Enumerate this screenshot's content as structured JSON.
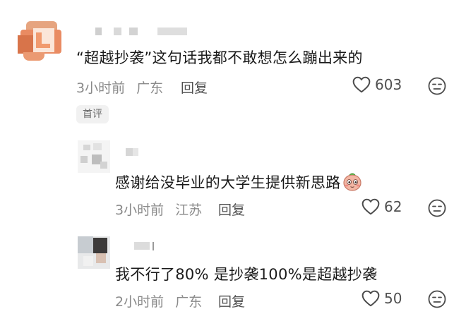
{
  "comments": [
    {
      "text": "“超越抄袭”这句话我都不敢想怎么蹦出来的",
      "time": "3小时前",
      "location": "广东",
      "reply": "回复",
      "likes": "603",
      "badge": "首评"
    },
    {
      "text": "感谢给没毕业的大学生提供新思路",
      "time": "3小时前",
      "location": "江苏",
      "reply": "回复",
      "likes": "62"
    },
    {
      "text": "我不行了80% 是抄袭100%是超越抄袭",
      "time": "2小时前",
      "location": "广东",
      "reply": "回复",
      "likes": "50"
    }
  ],
  "icons": {
    "like": "heart-outline-icon",
    "dislike": "unamused-face-icon",
    "emoji": "blushing-face-emoji"
  },
  "colors": {
    "text": "#1a1a1a",
    "meta": "#8a8a8a",
    "action": "#505050",
    "badge_bg": "#f1f1f1"
  }
}
